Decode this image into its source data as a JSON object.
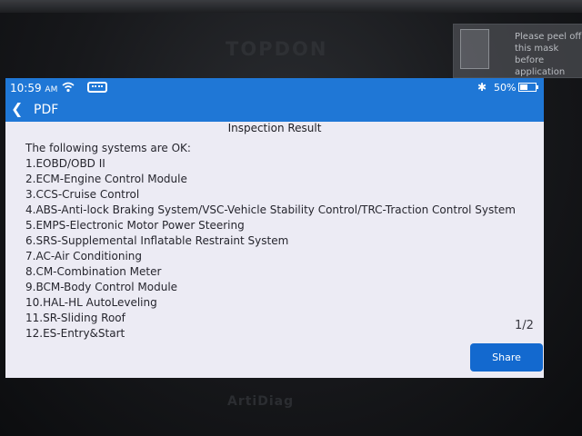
{
  "device": {
    "brand": "TOPDON",
    "model": "ArtiDiag",
    "peel_label": "Please peel off\nthis mask before\napplication"
  },
  "status_bar": {
    "time": "10:59",
    "ampm": "AM",
    "battery_text": "50%",
    "battery_level": 0.5
  },
  "header": {
    "back_icon": "chevron-left-icon",
    "title": "PDF"
  },
  "report": {
    "section_title": "Inspection Result",
    "intro": "The following systems are OK:",
    "items": [
      "1.EOBD/OBD II",
      "2.ECM-Engine Control Module",
      "3.CCS-Cruise Control",
      "4.ABS-Anti-lock Braking System/VSC-Vehicle Stability Control/TRC-Traction Control System",
      "5.EMPS-Electronic Motor Power Steering",
      "6.SRS-Supplemental Inflatable Restraint System",
      "7.AC-Air Conditioning",
      "8.CM-Combination Meter",
      "9.BCM-Body Control Module",
      "10.HAL-HL AutoLeveling",
      "11.SR-Sliding Roof",
      "12.ES-Entry&Start"
    ],
    "page_indicator": "1/2"
  },
  "actions": {
    "share_label": "Share"
  },
  "colors": {
    "accent": "#1f77d6",
    "screen_bg": "#ecebf4",
    "button": "#1369cf"
  }
}
